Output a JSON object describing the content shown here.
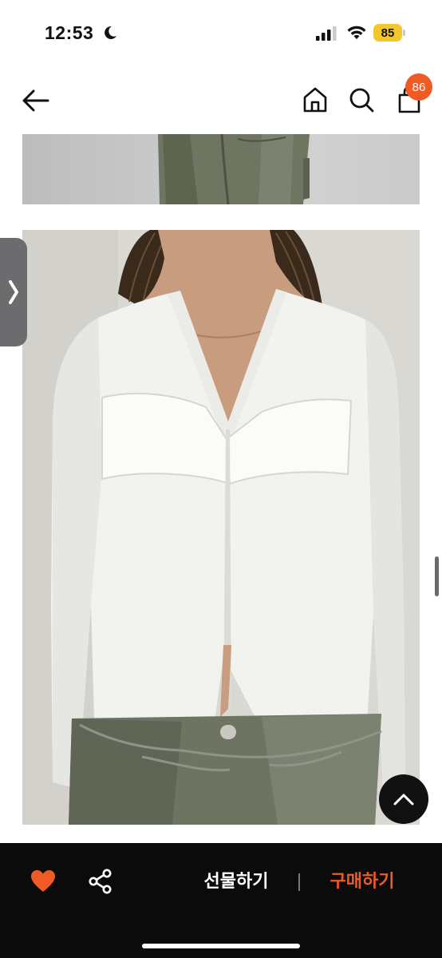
{
  "status_bar": {
    "time": "12:53",
    "battery_level": "85",
    "icons": [
      "moon-icon",
      "signal-icon",
      "wifi-icon",
      "battery-icon"
    ]
  },
  "nav": {
    "icons": [
      "back-arrow-icon",
      "home-icon",
      "search-icon",
      "cart-icon"
    ],
    "cart_count": "86",
    "accent_color": "#f05a24"
  },
  "product_images": [
    {
      "name": "product-photo-top",
      "subject": "olive green cargo pants"
    },
    {
      "name": "product-photo-main",
      "subject": "white ribbed v-neck zip cardigan with bustier overlay, olive jeans, chain belt"
    }
  ],
  "bottom_bar": {
    "wishlist_icon": "heart-icon",
    "share_icon": "share-icon",
    "gift_label": "선물하기",
    "buy_label": "구매하기",
    "buy_color": "#f05a24"
  }
}
